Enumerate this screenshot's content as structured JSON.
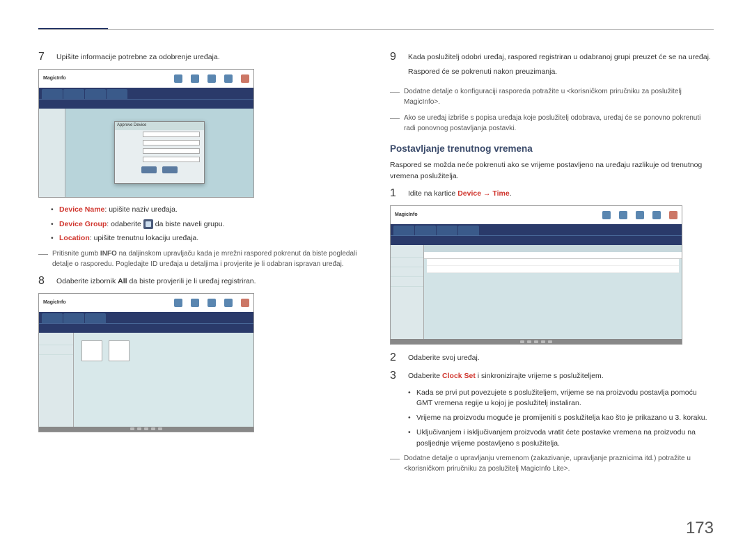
{
  "pageNumber": "173",
  "left": {
    "step7": {
      "num": "7",
      "text": "Upišite informacije potrebne za odobrenje uređaja."
    },
    "ssLogo": "MagicInfo",
    "ssDialogTitle": "Approve Device",
    "bullets": {
      "deviceName": {
        "label": "Device Name",
        "text": ": upišite naziv uređaja."
      },
      "deviceGroup": {
        "label": "Device Group",
        "text1": ": odaberite ",
        "text2": " da biste naveli grupu."
      },
      "location": {
        "label": "Location",
        "text": ": upišite trenutnu lokaciju uređaja."
      }
    },
    "note7": {
      "pre": "Pritisnite gumb ",
      "info": "INFO",
      "post": " na daljinskom upravljaču kada je mrežni raspored pokrenut da biste pogledali detalje o rasporedu. Pogledajte ID uređaja u detaljima i provjerite je li odabran ispravan uređaj."
    },
    "step8": {
      "num": "8",
      "pre": "Odaberite izbornik ",
      "all": "All",
      "post": " da biste provjerili je li uređaj registriran."
    }
  },
  "right": {
    "step9": {
      "num": "9",
      "line1": "Kada poslužitelj odobri uređaj, raspored registriran u odabranoj grupi preuzet će se na uređaj.",
      "line2": "Raspored će se pokrenuti nakon preuzimanja."
    },
    "notesA": {
      "n1": "Dodatne detalje o konfiguraciji rasporeda potražite u <korisničkom priručniku za poslužitelj MagicInfo>.",
      "n2": "Ako se uređaj izbriše s popisa uređaja koje poslužitelj odobrava, uređaj će se ponovno pokrenuti radi ponovnog postavljanja postavki."
    },
    "sectionTitle": "Postavljanje trenutnog vremena",
    "intro": "Raspored se možda neće pokrenuti ako se vrijeme postavljeno na uređaju razlikuje od trenutnog vremena poslužitelja.",
    "stepT1": {
      "num": "1",
      "pre": "Idite na kartice ",
      "device": "Device",
      "arrow": " → ",
      "time": "Time",
      "post": "."
    },
    "stepT2": {
      "num": "2",
      "text": "Odaberite svoj uređaj."
    },
    "stepT3": {
      "num": "3",
      "pre": "Odaberite ",
      "clockset": "Clock Set",
      "post": " i sinkronizirajte vrijeme s poslužiteljem."
    },
    "bulletsB": {
      "b1": "Kada se prvi put povezujete s poslužiteljem, vrijeme se na proizvodu postavlja pomoću GMT vremena regije u kojoj je poslužitelj instaliran.",
      "b2": "Vrijeme na proizvodu moguće je promijeniti s poslužitelja kao što je prikazano u 3. koraku.",
      "b3": "Uključivanjem i isključivanjem proizvoda vratit ćete postavke vremena na proizvodu na posljednje vrijeme postavljeno s poslužitelja."
    },
    "noteB": "Dodatne detalje o upravljanju vremenom (zakazivanje, upravljanje praznicima itd.) potražite u <korisničkom priručniku za poslužitelj MagicInfo Lite>."
  }
}
